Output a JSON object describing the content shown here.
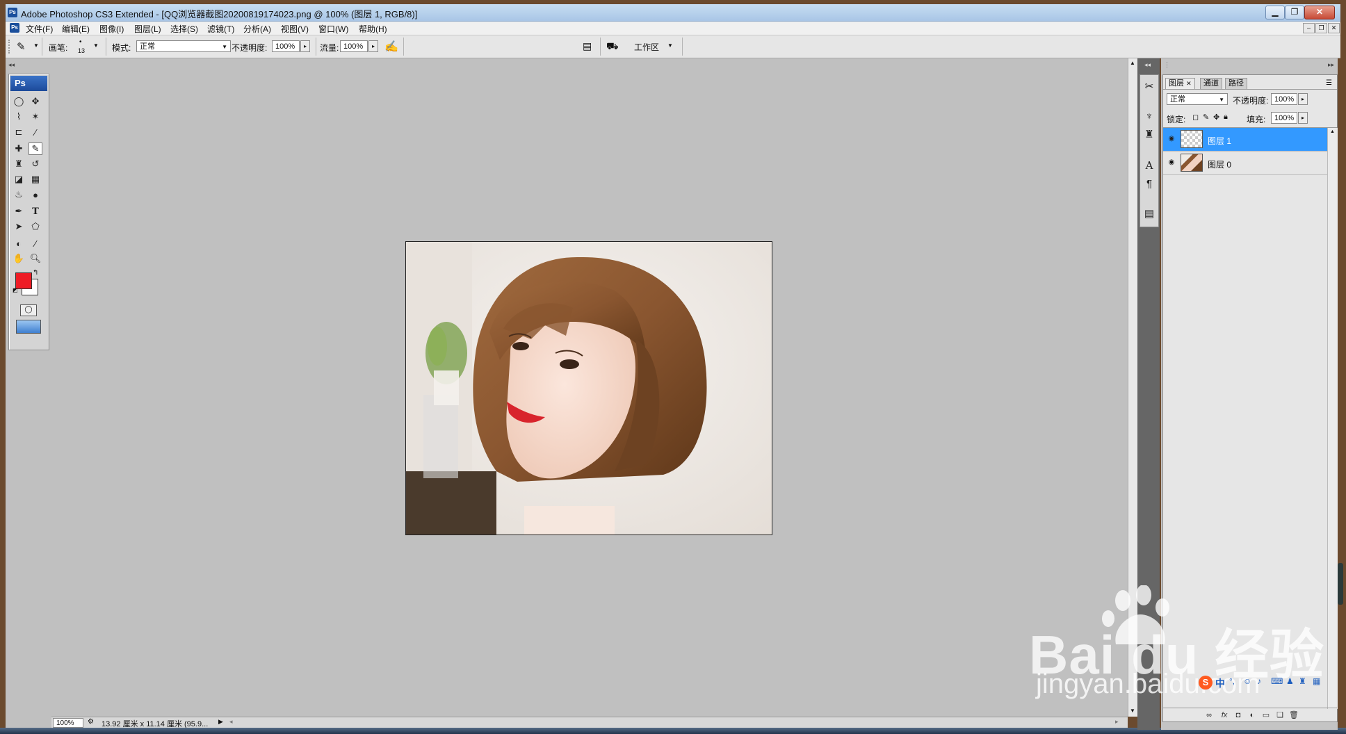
{
  "window": {
    "title": "Adobe Photoshop CS3 Extended - [QQ浏览器截图20200819174023.png @ 100% (图层 1, RGB/8)]"
  },
  "menu": [
    "文件(F)",
    "编辑(E)",
    "图像(I)",
    "图层(L)",
    "选择(S)",
    "滤镜(T)",
    "分析(A)",
    "视图(V)",
    "窗口(W)",
    "帮助(H)"
  ],
  "options": {
    "brush_label": "画笔:",
    "brush_size": "13",
    "mode_label": "模式:",
    "mode_value": "正常",
    "opacity_label": "不透明度:",
    "opacity_value": "100%",
    "flow_label": "流量:",
    "flow_value": "100%",
    "workspace_label": "工作区"
  },
  "toolbox": {
    "logo": "Ps",
    "foreground_color": "#ee1c25",
    "background_color": "#ffffff"
  },
  "status": {
    "zoom": "100%",
    "doc_info": "13.92 厘米 x 11.14 厘米 (95.9..."
  },
  "layers_panel": {
    "tabs": [
      "图层",
      "通道",
      "路径"
    ],
    "blend_mode": "正常",
    "opacity_label": "不透明度:",
    "opacity_value": "100%",
    "lock_label": "锁定:",
    "fill_label": "填充:",
    "fill_value": "100%",
    "layers": [
      {
        "name": "图层 1",
        "selected": true
      },
      {
        "name": "图层 0",
        "selected": false
      }
    ]
  },
  "watermark": {
    "brand": "Bai du 经验",
    "url": "jingyan.baidu.com"
  },
  "ime": {
    "label": "中"
  }
}
